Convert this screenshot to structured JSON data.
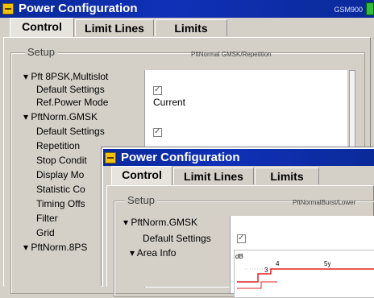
{
  "back_window": {
    "title": "Power Configuration",
    "device_tag": "GSM900",
    "tabs": [
      {
        "label": "Control"
      },
      {
        "label": "Limit Lines"
      },
      {
        "label": "Limits"
      }
    ],
    "setup_label": "Setup",
    "setup_subtitle": "PftNormal GMSK/Repetition",
    "tree": [
      {
        "label": "▾ Pft 8PSK,Multislot"
      },
      {
        "label": "Default Settings"
      },
      {
        "label": "Ref.Power Mode"
      },
      {
        "label": "▾ PftNorm.GMSK"
      },
      {
        "label": "Default Settings"
      },
      {
        "label": "Repetition"
      },
      {
        "label": "Stop Condit"
      },
      {
        "label": "Display Mo"
      },
      {
        "label": "Statistic Co"
      },
      {
        "label": "Timing Offs"
      },
      {
        "label": "Filter"
      },
      {
        "label": "Grid"
      },
      {
        "label": "▾ PftNorm.8PS"
      }
    ],
    "values": {
      "ref_power_mode": "Current"
    }
  },
  "front_window": {
    "title": "Power Configuration",
    "tabs": [
      {
        "label": "Control"
      },
      {
        "label": "Limit Lines"
      },
      {
        "label": "Limits"
      }
    ],
    "setup_label": "Setup",
    "setup_subtitle": "PftNormalBurst/Lower",
    "tree": [
      {
        "label": "▾ PftNorm.GMSK"
      },
      {
        "label": "Default Settings"
      },
      {
        "label": "▾ Area Info"
      }
    ],
    "chart": {
      "unit": "dB",
      "label_a": "4",
      "label_b": "5y",
      "label_c": "3"
    }
  },
  "colors": {
    "titlebar": "#0a2a9a",
    "window_bg": "#d4d0c8",
    "limit_line": "#e02020"
  }
}
